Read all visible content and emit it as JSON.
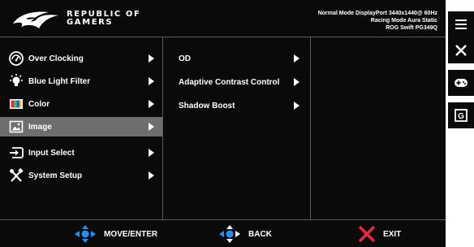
{
  "header": {
    "brand_line1": "REPUBLIC OF",
    "brand_line2": "GAMERS",
    "mode_line1": "Normal Mode DisplayPort 3440x1440@ 60Hz",
    "mode_line2": "Racing Mode Aura Static",
    "mode_line3": "ROG Swift PG349Q"
  },
  "main_menu": {
    "items": [
      {
        "label": "Over Clocking",
        "icon": "speedometer-icon",
        "selected": false
      },
      {
        "label": "Blue Light Filter",
        "icon": "bulb-icon",
        "selected": false
      },
      {
        "label": "Color",
        "icon": "color-palette-icon",
        "selected": false
      },
      {
        "label": "Image",
        "icon": "image-icon",
        "selected": true
      },
      {
        "label": "Input Select",
        "icon": "input-icon",
        "selected": false
      },
      {
        "label": "System Setup",
        "icon": "tools-icon",
        "selected": false
      }
    ]
  },
  "sub_menu": {
    "items": [
      {
        "label": "OD"
      },
      {
        "label": "Adaptive Contrast Control"
      },
      {
        "label": "Shadow Boost"
      }
    ]
  },
  "footer": {
    "move_label": "MOVE/ENTER",
    "back_label": "BACK",
    "exit_label": "EXIT"
  },
  "side_buttons": [
    "menu-icon",
    "close-icon",
    "gamepad-icon",
    "gameplus-icon"
  ],
  "side_button_labels": {
    "gameplus": "G"
  },
  "colors": {
    "background": "#0a0a0a",
    "selected": "#6e6e6e",
    "accent_blue": "#1e90ff",
    "exit_red": "#e8283c"
  }
}
